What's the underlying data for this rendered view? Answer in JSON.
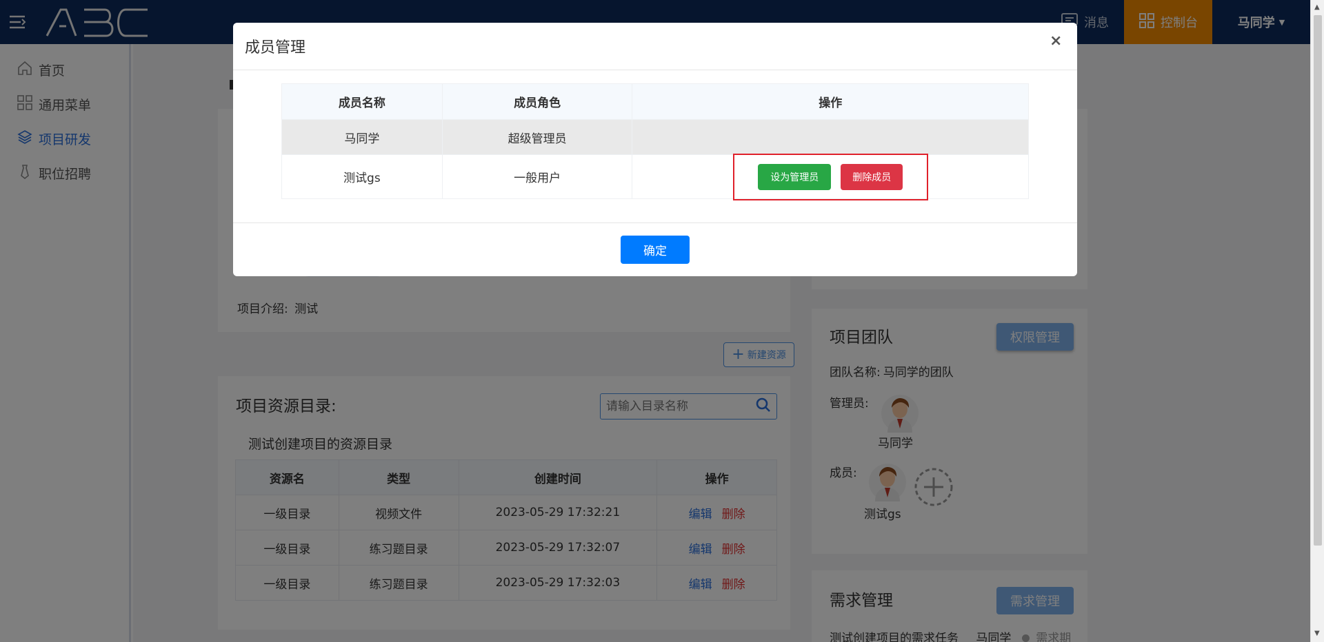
{
  "topbar": {
    "logo_text": "ABC",
    "messages_label": "消息",
    "console_label": "控制台",
    "user_label": "马同学"
  },
  "sidebar": {
    "items": [
      {
        "label": "首页",
        "icon": "home-icon"
      },
      {
        "label": "通用菜单",
        "icon": "grid-icon"
      },
      {
        "label": "项目研发",
        "icon": "layers-icon",
        "active": true
      },
      {
        "label": "职位招聘",
        "icon": "tie-icon"
      }
    ]
  },
  "project": {
    "intro_label": "项目介绍:",
    "intro_value": "测试",
    "new_resource_label": "新建资源"
  },
  "resources": {
    "title": "项目资源目录:",
    "search_placeholder": "请输入目录名称",
    "subtitle": "测试创建项目的资源目录",
    "columns": [
      "资源名",
      "类型",
      "创建时间",
      "操作"
    ],
    "rows": [
      {
        "name": "一级目录",
        "type": "视频文件",
        "created": "2023-05-29 17:32:21"
      },
      {
        "name": "一级目录",
        "type": "练习题目录",
        "created": "2023-05-29 17:32:07"
      },
      {
        "name": "一级目录",
        "type": "练习题目录",
        "created": "2023-05-29 17:32:03"
      }
    ],
    "edit_label": "编辑",
    "delete_label": "删除"
  },
  "team": {
    "title": "项目团队",
    "permission_button": "权限管理",
    "team_name_label": "团队名称:",
    "team_name_value": "马同学的团队",
    "admin_label": "管理员:",
    "admin_name": "马同学",
    "member_label": "成员:",
    "member_name": "测试gs"
  },
  "requirements": {
    "title": "需求管理",
    "button": "需求管理",
    "task_name": "测试创建项目的需求任务",
    "task_owner": "马同学",
    "task_status": "需求期"
  },
  "modal": {
    "title": "成员管理",
    "close_label": "×",
    "columns": [
      "成员名称",
      "成员角色",
      "操作"
    ],
    "rows": [
      {
        "name": "马同学",
        "role": "超级管理员"
      },
      {
        "name": "测试gs",
        "role": "一般用户"
      }
    ],
    "set_admin_label": "设为管理员",
    "remove_member_label": "删除成员",
    "confirm_label": "确定"
  },
  "colors": {
    "topbar": "#0d2a5c",
    "console": "#f28a00",
    "primary": "#007bff",
    "success": "#28a745",
    "danger": "#dc3545",
    "highlight": "#e0202a"
  }
}
